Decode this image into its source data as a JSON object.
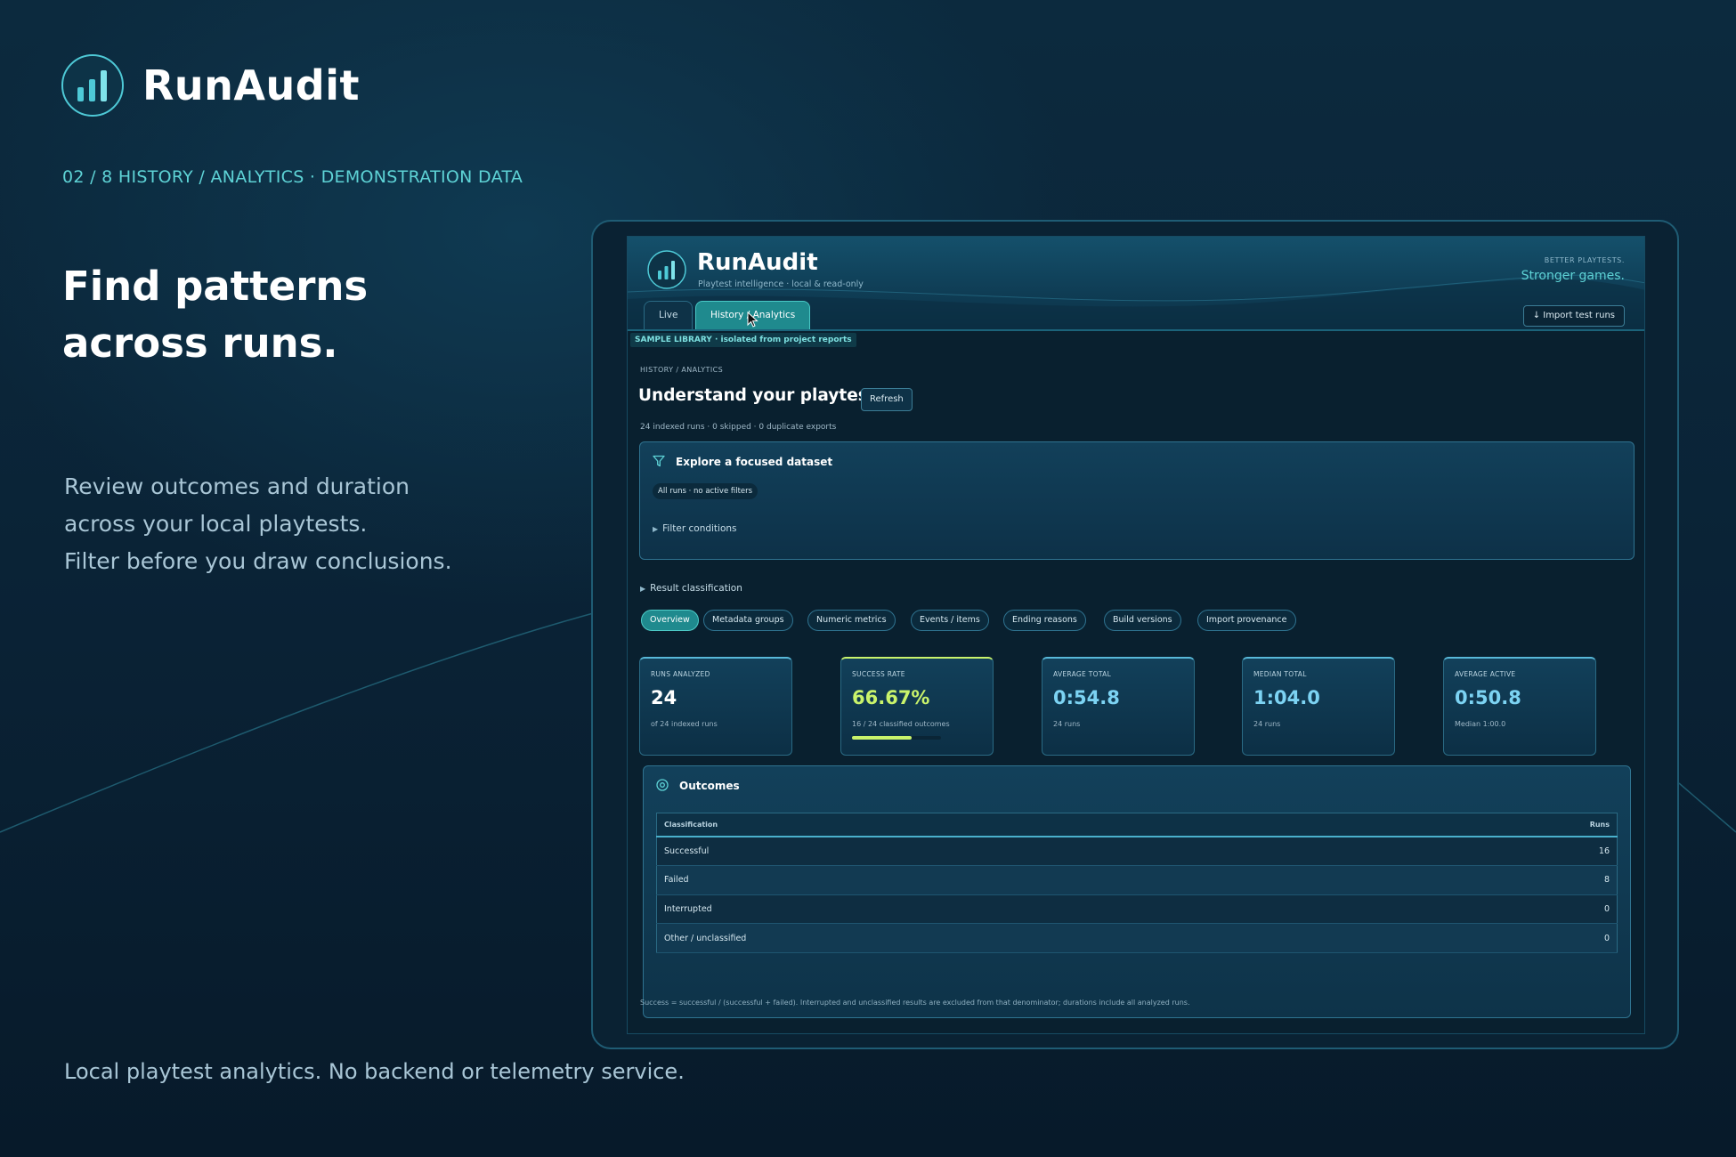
{
  "brand": {
    "name": "RunAudit"
  },
  "slide": {
    "kicker": "02 / 8 HISTORY / ANALYTICS · DEMONSTRATION DATA",
    "headline_line1": "Find patterns",
    "headline_line2": "across runs.",
    "body_line1": "Review outcomes and duration",
    "body_line2": "across your local playtests.",
    "body_line3": "Filter before you draw conclusions.",
    "footer": "Local playtest analytics. No backend or telemetry service."
  },
  "app": {
    "title": "RunAudit",
    "subtitle": "Playtest intelligence · local & read-only",
    "tagline_small": "BETTER PLAYTESTS.",
    "tagline_big": "Stronger games.",
    "tabs": [
      {
        "label": "Live"
      },
      {
        "label": "History / Analytics"
      }
    ],
    "import_label": "↓ Import test runs",
    "sample_badge": "SAMPLE LIBRARY · isolated from project reports"
  },
  "page": {
    "breadcrumb": "HISTORY / ANALYTICS",
    "title": "Understand your playtests",
    "refresh_label": "Refresh",
    "index_meta": "24 indexed runs · 0 skipped · 0 duplicate exports"
  },
  "filter": {
    "title": "Explore a focused dataset",
    "chip": "All runs · no active filters",
    "conditions_label": "Filter conditions"
  },
  "result_classification_label": "Result classification",
  "views": [
    {
      "label": "Overview",
      "active": true
    },
    {
      "label": "Metadata groups"
    },
    {
      "label": "Numeric metrics"
    },
    {
      "label": "Events / items"
    },
    {
      "label": "Ending reasons"
    },
    {
      "label": "Build versions"
    },
    {
      "label": "Import provenance"
    }
  ],
  "metrics": [
    {
      "label": "RUNS ANALYZED",
      "value": "24",
      "sub": "of 24 indexed runs"
    },
    {
      "label": "SUCCESS RATE",
      "value": "66.67%",
      "sub": "16 / 24 classified outcomes",
      "fraction": 0.6667
    },
    {
      "label": "AVERAGE TOTAL",
      "value": "0:54.8",
      "sub": "24 runs"
    },
    {
      "label": "MEDIAN TOTAL",
      "value": "1:04.0",
      "sub": "24 runs"
    },
    {
      "label": "AVERAGE ACTIVE",
      "value": "0:50.8",
      "sub": "Median 1:00.0"
    }
  ],
  "outcomes": {
    "title": "Outcomes",
    "columns": [
      "Classification",
      "Runs"
    ],
    "rows": [
      [
        "Successful",
        "16"
      ],
      [
        "Failed",
        "8"
      ],
      [
        "Interrupted",
        "0"
      ],
      [
        "Other / unclassified",
        "0"
      ]
    ]
  },
  "footnote": "Success = successful / (successful + failed). Interrupted and unclassified results are excluded from that denominator; durations include all analyzed runs.",
  "colors": {
    "accent": "#5ed3d6",
    "success": "#c9f36b",
    "metric_blue": "#7cd3f3",
    "tab_active": "#1f8a8e"
  }
}
